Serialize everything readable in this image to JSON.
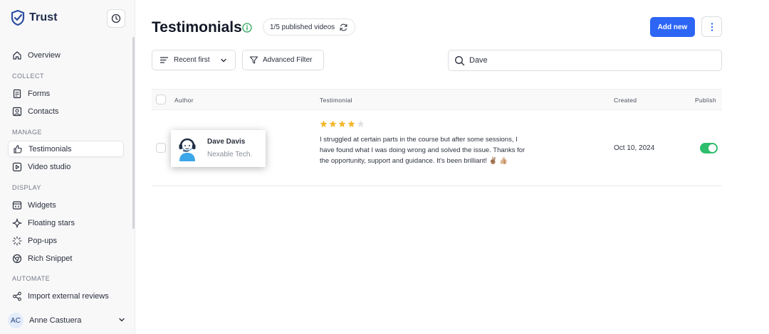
{
  "brand": {
    "name": "Trust"
  },
  "sidebar": {
    "overview": "Overview",
    "sections": {
      "collect": "COLLECT",
      "manage": "MANAGE",
      "display": "DISPLAY",
      "automate": "AUTOMATE"
    },
    "items": {
      "forms": "Forms",
      "contacts": "Contacts",
      "testimonials": "Testimonials",
      "video_studio": "Video studio",
      "widgets": "Widgets",
      "floating_stars": "Floating stars",
      "popups": "Pop-ups",
      "rich_snippet": "Rich Snippet",
      "import_reviews": "Import external reviews"
    },
    "user": {
      "initials": "AC",
      "name": "Anne Castuera"
    }
  },
  "header": {
    "title": "Testimonials",
    "published_badge": "1/5 published videos",
    "add_button": "Add new"
  },
  "toolbar": {
    "sort_label": "Recent first",
    "filter_label": "Advanced Filter",
    "search_value": "Dave"
  },
  "table": {
    "columns": {
      "author": "Author",
      "testimonial": "Testimonial",
      "created": "Created",
      "publish": "Publish"
    },
    "rows": [
      {
        "author_name": "Dave Davis",
        "author_company": "Nexable Tech.",
        "rating": 4,
        "rating_max": 5,
        "text": "I struggled at certain parts in the course but after some sessions, I have found what I was doing wrong and solved the issue. Thanks for the opportunity, support and guidance. It's been brilliant! ✌🏽 👍🏼",
        "created": "Oct 10, 2024",
        "published": true
      }
    ]
  },
  "colors": {
    "accent": "#2d66f5",
    "toggle_on": "#2fbe6d",
    "star": "#f5b82e",
    "star_empty": "#e1e2e6",
    "brand": "#2d4fa0"
  }
}
